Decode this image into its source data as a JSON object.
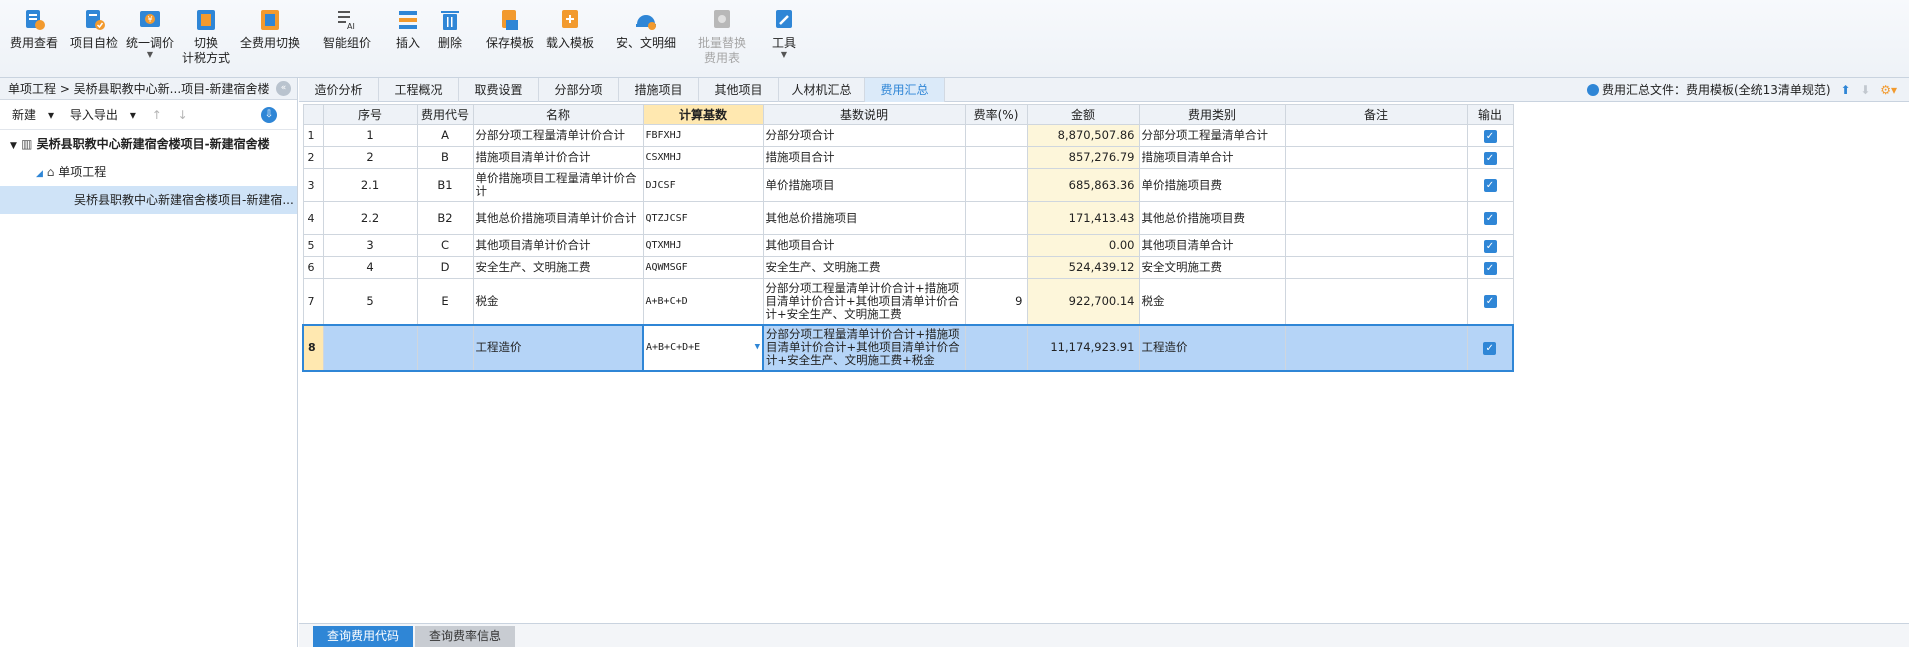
{
  "toolbar": {
    "buttons": [
      {
        "label": "费用查看",
        "icon": "fee-view-icon"
      },
      {
        "label": "项目自检",
        "icon": "project-check-icon"
      },
      {
        "label": "统一调价",
        "icon": "unified-price-icon",
        "dropdown": true
      },
      {
        "label": "切换",
        "label2": "计税方式",
        "icon": "switch-tax-icon"
      },
      {
        "label": "全费用切换",
        "icon": "full-cost-switch-icon"
      },
      {
        "label": "智能组价",
        "icon": "smart-pricing-icon"
      },
      {
        "label": "插入",
        "icon": "insert-icon"
      },
      {
        "label": "删除",
        "icon": "delete-icon"
      },
      {
        "label": "保存模板",
        "icon": "save-template-icon"
      },
      {
        "label": "载入模板",
        "icon": "load-template-icon"
      },
      {
        "label": "安、文明细",
        "icon": "safety-detail-icon"
      },
      {
        "label": "批量替换",
        "label2": "费用表",
        "icon": "batch-replace-icon",
        "disabled": true
      },
      {
        "label": "工具",
        "icon": "tools-icon",
        "dropdown": true
      }
    ]
  },
  "left": {
    "breadcrumb": "单项工程 > 吴桥县职教中心新...项目-新建宿舍楼",
    "tools": {
      "new": "新建",
      "import_export": "导入导出",
      "up": "↑",
      "down": "↓"
    },
    "tree": {
      "root": "吴桥县职教中心新建宿舍楼项目-新建宿舍楼",
      "level1": "单项工程",
      "level2": "吴桥县职教中心新建宿舍楼项目-新建宿..."
    }
  },
  "tabs": [
    "造价分析",
    "工程概况",
    "取费设置",
    "分部分项",
    "措施项目",
    "其他项目",
    "人材机汇总",
    "费用汇总"
  ],
  "active_tab": "费用汇总",
  "summary_file": "费用汇总文件：费用模板(全统13清单规范)",
  "grid": {
    "headers": [
      "序号",
      "费用代号",
      "名称",
      "计算基数",
      "基数说明",
      "费率(%)",
      "金额",
      "费用类别",
      "备注",
      "输出"
    ],
    "rows": [
      {
        "rn": "1",
        "seq": "1",
        "code": "A",
        "name": "分部分项工程量清单计价合计",
        "basis": "FBFXHJ",
        "desc": "分部分项合计",
        "rate": "",
        "amount": "8,870,507.86",
        "category": "分部分项工程量清单合计",
        "remark": "",
        "output": true
      },
      {
        "rn": "2",
        "seq": "2",
        "code": "B",
        "name": "措施项目清单计价合计",
        "basis": "CSXMHJ",
        "desc": "措施项目合计",
        "rate": "",
        "amount": "857,276.79",
        "category": "措施项目清单合计",
        "remark": "",
        "output": true
      },
      {
        "rn": "3",
        "seq": "2.1",
        "code": "B1",
        "name": "单价措施项目工程量清单计价合计",
        "basis": "DJCSF",
        "desc": "单价措施项目",
        "rate": "",
        "amount": "685,863.36",
        "category": "单价措施项目费",
        "remark": "",
        "output": true
      },
      {
        "rn": "4",
        "seq": "2.2",
        "code": "B2",
        "name": "其他总价措施项目清单计价合计",
        "basis": "QTZJCSF",
        "desc": "其他总价措施项目",
        "rate": "",
        "amount": "171,413.43",
        "category": "其他总价措施项目费",
        "remark": "",
        "output": true
      },
      {
        "rn": "5",
        "seq": "3",
        "code": "C",
        "name": "其他项目清单计价合计",
        "basis": "QTXMHJ",
        "desc": "其他项目合计",
        "rate": "",
        "amount": "0.00",
        "category": "其他项目清单合计",
        "remark": "",
        "output": true
      },
      {
        "rn": "6",
        "seq": "4",
        "code": "D",
        "name": "安全生产、文明施工费",
        "basis": "AQWMSGF",
        "desc": "安全生产、文明施工费",
        "rate": "",
        "amount": "524,439.12",
        "category": "安全文明施工费",
        "remark": "",
        "output": true
      },
      {
        "rn": "7",
        "seq": "5",
        "code": "E",
        "name": "税金",
        "basis": "A+B+C+D",
        "desc": "分部分项工程量清单计价合计+措施项目清单计价合计+其他项目清单计价合计+安全生产、文明施工费",
        "rate": "9",
        "amount": "922,700.14",
        "category": "税金",
        "remark": "",
        "output": true
      },
      {
        "rn": "8",
        "seq": "",
        "code": "",
        "name": "工程造价",
        "basis": "A+B+C+D+E",
        "desc": "分部分项工程量清单计价合计+措施项目清单计价合计+其他项目清单计价合计+安全生产、文明施工费+税金",
        "rate": "",
        "amount": "11,174,923.91",
        "category": "工程造价",
        "remark": "",
        "output": true
      }
    ]
  },
  "bottom_tabs": [
    "查询费用代码",
    "查询费率信息"
  ]
}
